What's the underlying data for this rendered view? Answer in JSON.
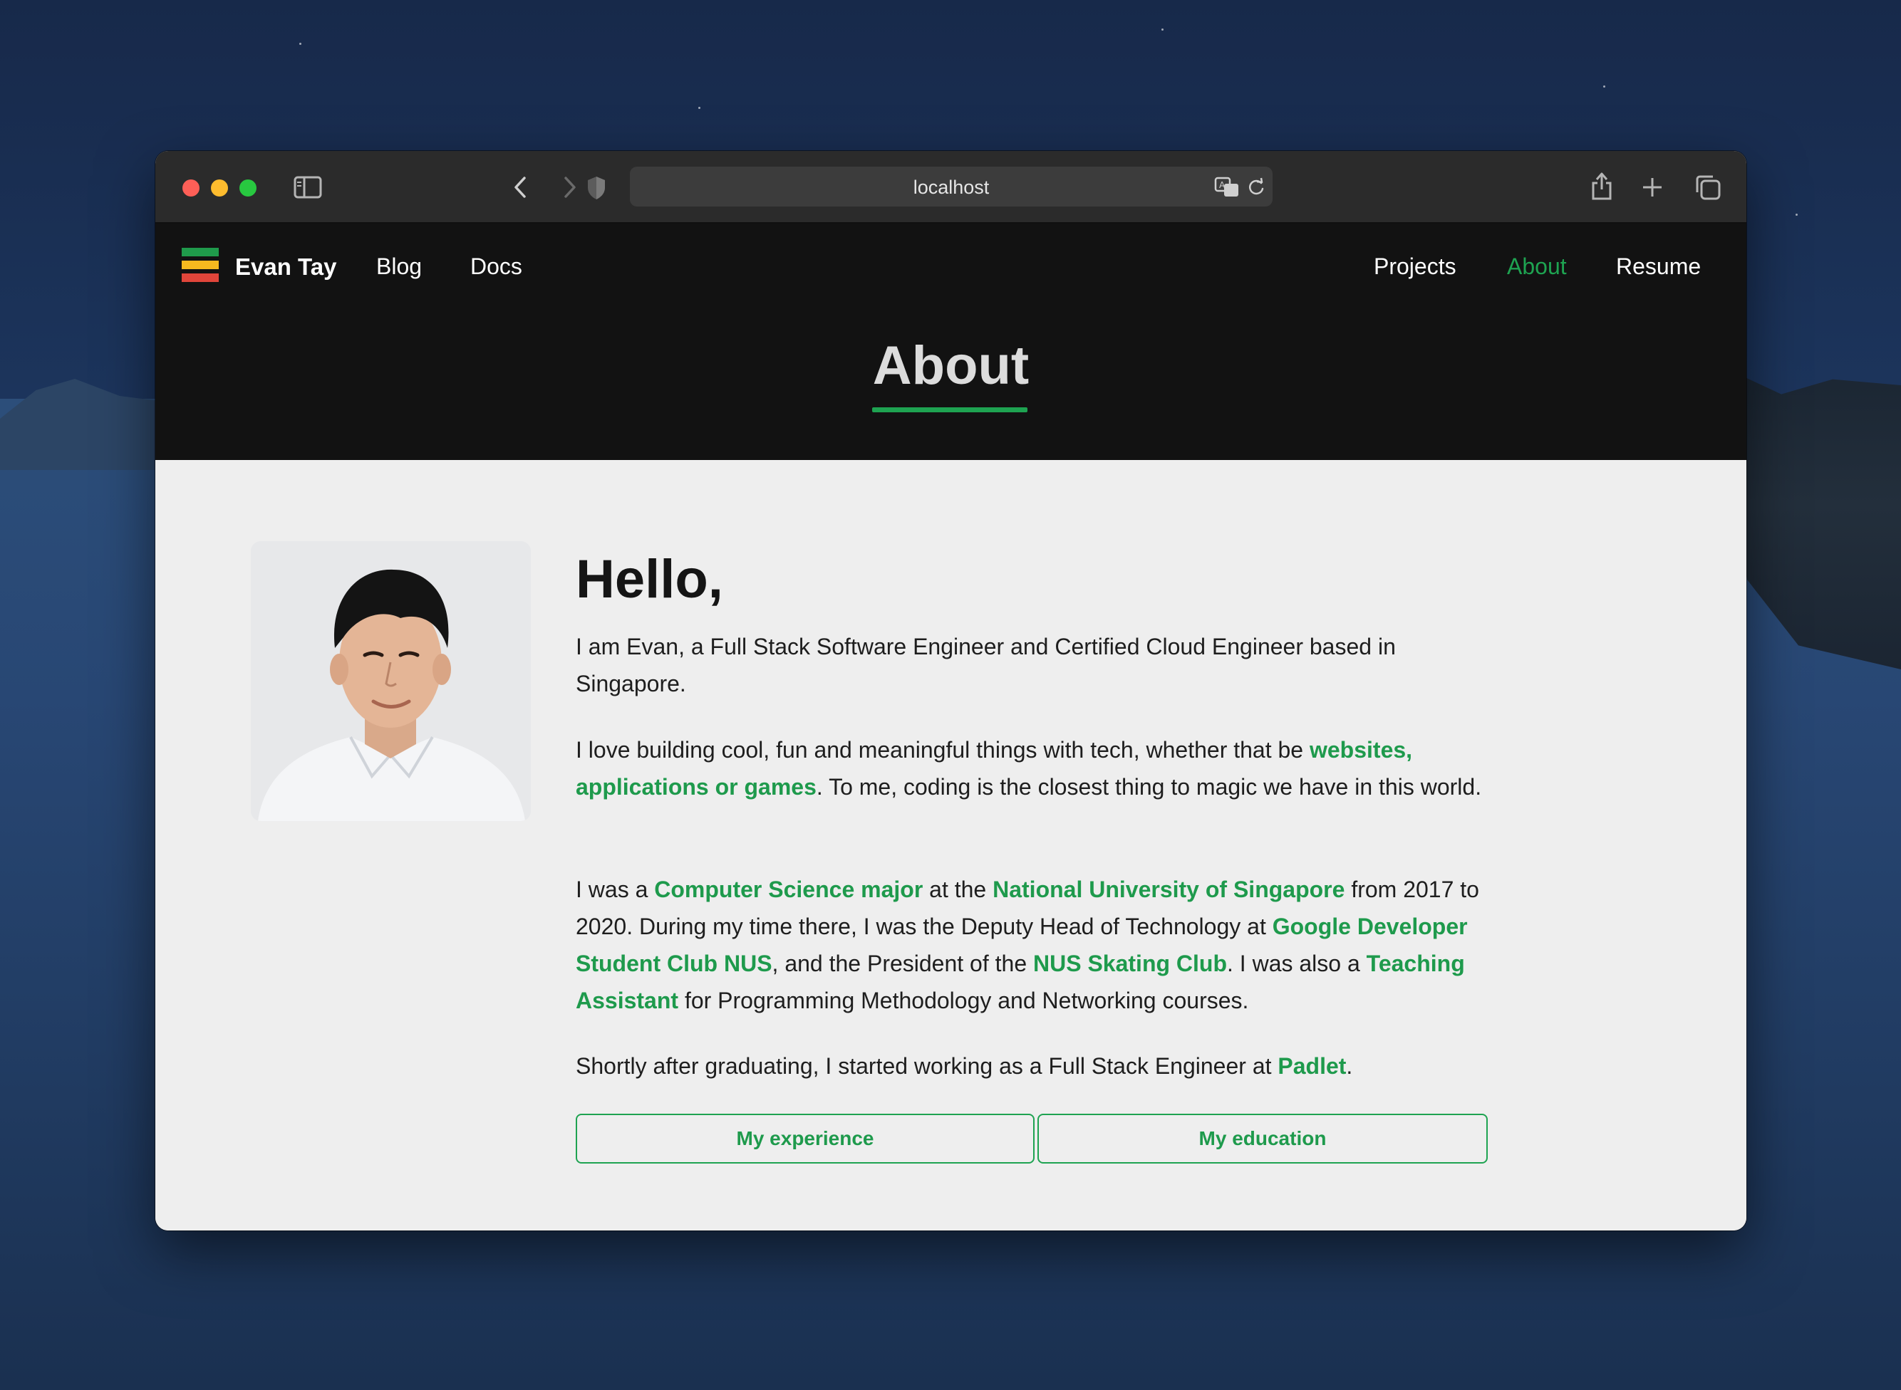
{
  "browser": {
    "url": "localhost"
  },
  "site": {
    "brand": "Evan Tay",
    "nav_left": [
      "Blog",
      "Docs"
    ],
    "nav_right": [
      "Projects",
      "About",
      "Resume"
    ],
    "active_nav": "About",
    "page_title": "About",
    "accent_color": "#1ea351"
  },
  "about": {
    "greeting": "Hello,",
    "p1": "I am Evan, a Full Stack Software Engineer and Certified Cloud Engineer based in Singapore.",
    "p2": {
      "a": "I love building cool, fun and meaningful things with tech, whether that be ",
      "link": "websites, applications or games",
      "b": ". To me, coding is the closest thing to magic we have in this world."
    },
    "p3": {
      "t1": "I was a ",
      "l1": "Computer Science major",
      "t2": " at the ",
      "l2": "National University of Singapore",
      "t3": " from 2017 to 2020. During my time there, I was the Deputy Head of Technology at ",
      "l3": "Google Developer Student Club NUS",
      "t4": ", and the President of the ",
      "l4": "NUS Skating Club",
      "t5": ". I was also a ",
      "l5": "Teaching Assistant",
      "t6": " for Programming Methodology and Networking courses."
    },
    "p4": {
      "a": "Shortly after graduating, I started working as a Full Stack Engineer at ",
      "link": "Padlet",
      "b": "."
    },
    "buttons": [
      "My experience",
      "My education"
    ]
  }
}
